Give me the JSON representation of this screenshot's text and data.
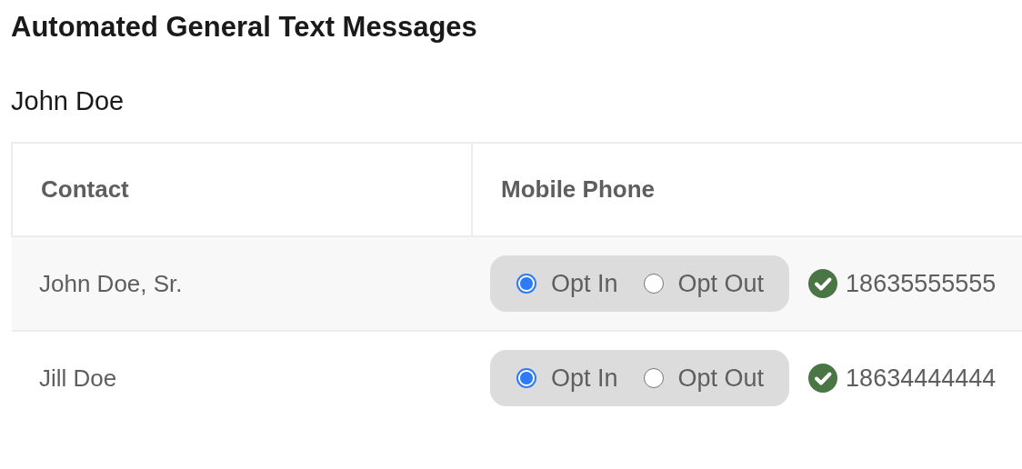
{
  "title": "Automated General Text Messages",
  "name": "John Doe",
  "table": {
    "columns": [
      "Contact",
      "Mobile Phone"
    ],
    "rows": [
      {
        "contact": "John Doe, Sr.",
        "options": [
          {
            "label": "Opt In",
            "selected": true
          },
          {
            "label": "Opt Out",
            "selected": false
          }
        ],
        "verified": true,
        "phone": "18635555555"
      },
      {
        "contact": "Jill Doe",
        "options": [
          {
            "label": "Opt In",
            "selected": true
          },
          {
            "label": "Opt Out",
            "selected": false
          }
        ],
        "verified": true,
        "phone": "18634444444"
      }
    ]
  }
}
